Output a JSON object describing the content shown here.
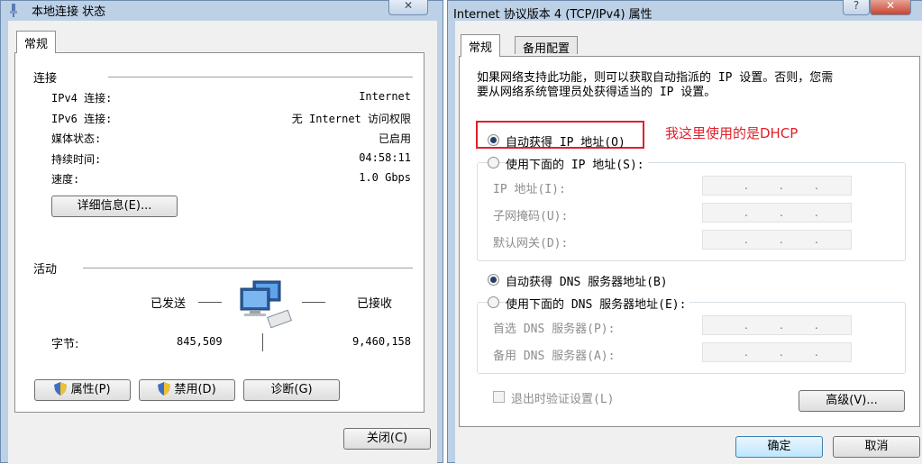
{
  "left_window": {
    "title": "本地连接 状态",
    "tab": "常规",
    "connection_section": "连接",
    "rows": [
      {
        "label": "IPv4 连接:",
        "value": "Internet"
      },
      {
        "label": "IPv6 连接:",
        "value": "无 Internet 访问权限"
      },
      {
        "label": "媒体状态:",
        "value": "已启用"
      },
      {
        "label": "持续时间:",
        "value": "04:58:11"
      },
      {
        "label": "速度:",
        "value": "1.0 Gbps"
      }
    ],
    "details_button": "详细信息(E)...",
    "activity_section": "活动",
    "sent_label": "已发送",
    "received_label": "已接收",
    "bytes_label": "字节:",
    "bytes_sent": "845,509",
    "bytes_received": "9,460,158",
    "properties_button": "属性(P)",
    "disable_button": "禁用(D)",
    "diagnose_button": "诊断(G)",
    "close_button": "关闭(C)"
  },
  "right_window": {
    "title": "Internet 协议版本 4 (TCP/IPv4) 属性",
    "tabs": [
      "常规",
      "备用配置"
    ],
    "description_line1": "如果网络支持此功能，则可以获取自动指派的 IP 设置。否则，您需",
    "description_line2": "要从网络系统管理员处获得适当的 IP 设置。",
    "auto_ip_radio": "自动获得 IP 地址(O)",
    "annotation": "我这里使用的是DHCP",
    "manual_ip_radio": "使用下面的 IP 地址(S):",
    "ip_fields": [
      {
        "label": "IP 地址(I):"
      },
      {
        "label": "子网掩码(U):"
      },
      {
        "label": "默认网关(D):"
      }
    ],
    "auto_dns_radio": "自动获得 DNS 服务器地址(B)",
    "manual_dns_radio": "使用下面的 DNS 服务器地址(E):",
    "dns_fields": [
      {
        "label": "首选 DNS 服务器(P):"
      },
      {
        "label": "备用 DNS 服务器(A):"
      }
    ],
    "validate_checkbox": "退出时验证设置(L)",
    "advanced_button": "高级(V)...",
    "ok_button": "确定",
    "cancel_button": "取消",
    "ip_dot": "."
  },
  "colors": {
    "annotation_red": "#e0202a",
    "frame_blue": "#bcd0e6"
  }
}
